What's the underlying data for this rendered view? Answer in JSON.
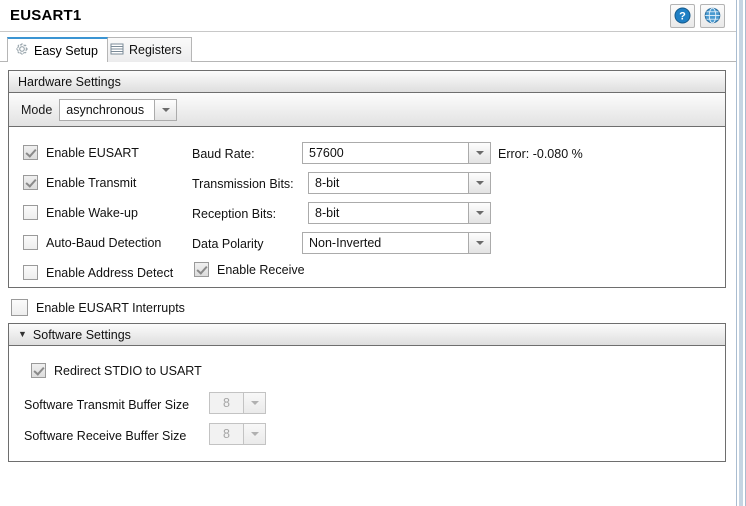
{
  "window": {
    "title": "EUSART1",
    "buttons": [
      {
        "name": "help-button",
        "icon": "question-mark-icon",
        "tooltip": "Help"
      },
      {
        "name": "datasheet-button",
        "icon": "globe-icon",
        "tooltip": "Open online"
      }
    ]
  },
  "tabs": [
    {
      "label": "Easy Setup",
      "icon": "gear-icon",
      "active": true
    },
    {
      "label": "Registers",
      "icon": "registers-table-icon",
      "active": false
    }
  ],
  "hardware": {
    "header": "Hardware Settings",
    "mode": {
      "label": "Mode",
      "value": "asynchronous"
    },
    "checkboxes": [
      {
        "label": "Enable EUSART",
        "checked": true
      },
      {
        "label": "Enable Transmit",
        "checked": true
      },
      {
        "label": "Enable Wake-up",
        "checked": false
      },
      {
        "label": "Auto-Baud Detection",
        "checked": false
      },
      {
        "label": "Enable Address Detect",
        "checked": false
      }
    ],
    "fields": [
      {
        "label": "Baud Rate:",
        "value": "57600"
      },
      {
        "label": "Transmission Bits:",
        "value": "8-bit"
      },
      {
        "label": "Reception Bits:",
        "value": "8-bit"
      },
      {
        "label": "Data Polarity",
        "value": "Non-Inverted"
      }
    ],
    "error_text": "Error: -0.080 %",
    "enable_receive": {
      "label": "Enable Receive",
      "checked": true
    }
  },
  "interrupts": {
    "label": "Enable EUSART Interrupts",
    "checked": false
  },
  "software": {
    "header": "Software Settings",
    "twisty": "▼",
    "redirect": {
      "label": "Redirect STDIO to USART",
      "checked": true
    },
    "transmit_buffer": {
      "label": "Software Transmit Buffer Size",
      "value": "8"
    },
    "receive_buffer": {
      "label": "Software Receive Buffer Size",
      "value": "8"
    }
  },
  "colors": {
    "accent": "#3b95d3",
    "panel_border": "#6e6e6e",
    "rail": "#c5d4e2"
  }
}
